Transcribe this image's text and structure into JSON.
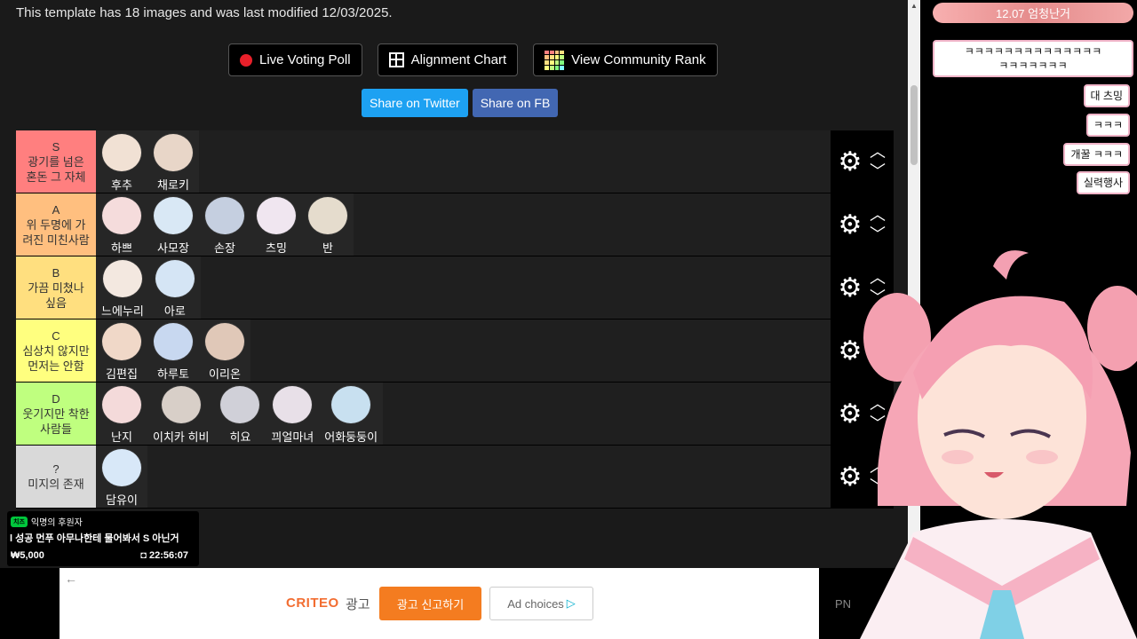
{
  "info_text": "This template has 18 images and was last modified 12/03/2025.",
  "buttons": {
    "live_poll": "Live Voting Poll",
    "alignment": "Alignment Chart",
    "community_rank": "View Community Rank",
    "twitter": "Share on Twitter",
    "facebook": "Share on FB"
  },
  "colors": {
    "twitter": "#1da1f2",
    "facebook": "#4267b2",
    "tier_s": "#ff7f7f",
    "tier_a": "#ffbf7f",
    "tier_b": "#ffdf7f",
    "tier_c": "#ffff7f",
    "tier_d": "#bfff7f",
    "tier_q": "#d9d9d9"
  },
  "tiers": [
    {
      "letter": "S",
      "desc1": "광기를 넘은",
      "desc2": "혼돈 그 자체",
      "items": [
        "후추",
        "채로키"
      ]
    },
    {
      "letter": "A",
      "desc1": "위 두명에 가",
      "desc2": "려진 미친사람",
      "items": [
        "하쁘",
        "사모장",
        "손장",
        "츠밍",
        "반"
      ]
    },
    {
      "letter": "B",
      "desc1": "가끔 미쳤나",
      "desc2": "싶음",
      "items": [
        "느에누리",
        "아로"
      ]
    },
    {
      "letter": "C",
      "desc1": "심상치 않지만",
      "desc2": "먼저는 안함",
      "items": [
        "김편집",
        "하루토",
        "이리온"
      ]
    },
    {
      "letter": "D",
      "desc1": "웃기지만 착한",
      "desc2": "사람들",
      "items": [
        "난지",
        "이치카 히비",
        "히요",
        "끠얼마녀",
        "어화둥둥이"
      ]
    },
    {
      "letter": "?",
      "desc1": "미지의 존재",
      "desc2": "",
      "items": [
        "담유이"
      ]
    }
  ],
  "ad": {
    "back": "←",
    "brand": "CRITEO",
    "label": "광고",
    "report": "광고 신고하기",
    "choices": "Ad choices",
    "pn": "PN"
  },
  "donation": {
    "badge": "치즈",
    "donor": "익명의 후원자",
    "message": "l 성공 먼푸 아무나한테 물어봐서 S 아닌거",
    "amount": "₩5,000",
    "time": "22:56:07"
  },
  "chat": {
    "top": "12.07 엄청난거",
    "msgs": [
      "ㅋㅋㅋㅋㅋㅋㅋㅋㅋㅋㅋㅋㅋㅋ",
      "ㅋㅋㅋㅋㅋㅋㅋ",
      "대 츠밍",
      "ㅋㅋㅋ",
      "개꿀 ㅋㅋㅋ",
      "실력행사"
    ]
  }
}
